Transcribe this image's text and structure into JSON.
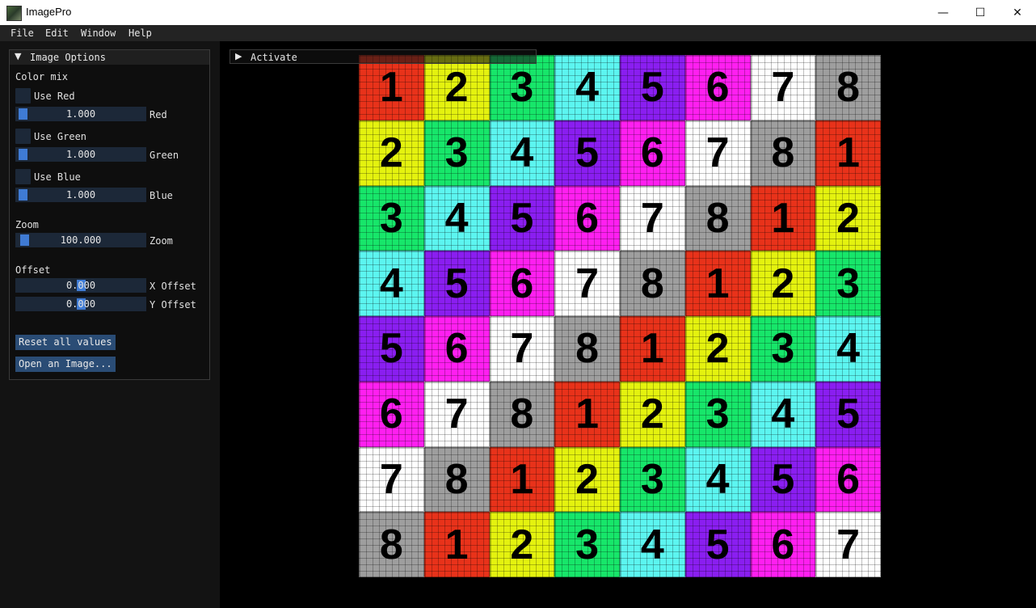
{
  "window": {
    "title": "ImagePro",
    "controls": [
      "—",
      "☐",
      "✕"
    ]
  },
  "menu": [
    "File",
    "Edit",
    "Window",
    "Help"
  ],
  "options": {
    "header": "Image Options",
    "color_mix_label": "Color mix",
    "use_red": "Use Red",
    "red_value": "1.000",
    "red_label": "Red",
    "use_green": "Use Green",
    "green_value": "1.000",
    "green_label": "Green",
    "use_blue": "Use Blue",
    "blue_value": "1.000",
    "blue_label": "Blue",
    "zoom_section": "Zoom",
    "zoom_value": "100.000",
    "zoom_label": "Zoom",
    "offset_section": "Offset",
    "x_offset_value": "0.000",
    "x_offset_label": "X Offset",
    "y_offset_value": "0.000",
    "y_offset_label": "Y Offset",
    "reset_button": "Reset all values",
    "open_button": "Open an Image..."
  },
  "activate": {
    "label": "Activate"
  },
  "colors": {
    "1": "#e8321a",
    "2": "#e4f20f",
    "3": "#17e66a",
    "4": "#5cf5f0",
    "5": "#8a1ef0",
    "6": "#ff1ff0",
    "7": "#ffffff",
    "8": "#9e9e9e"
  },
  "grid": [
    [
      "1",
      "2",
      "3",
      "4",
      "5",
      "6",
      "7",
      "8"
    ],
    [
      "2",
      "3",
      "4",
      "5",
      "6",
      "7",
      "8",
      "1"
    ],
    [
      "3",
      "4",
      "5",
      "6",
      "7",
      "8",
      "1",
      "2"
    ],
    [
      "4",
      "5",
      "6",
      "7",
      "8",
      "1",
      "2",
      "3"
    ],
    [
      "5",
      "6",
      "7",
      "8",
      "1",
      "2",
      "3",
      "4"
    ],
    [
      "6",
      "7",
      "8",
      "1",
      "2",
      "3",
      "4",
      "5"
    ],
    [
      "7",
      "8",
      "1",
      "2",
      "3",
      "4",
      "5",
      "6"
    ],
    [
      "8",
      "1",
      "2",
      "3",
      "4",
      "5",
      "6",
      "7"
    ]
  ]
}
